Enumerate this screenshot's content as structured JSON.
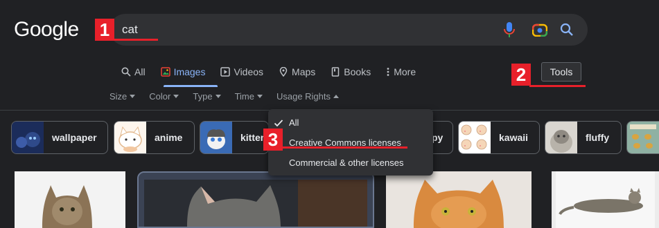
{
  "header": {
    "logo": "Google",
    "query": "cat"
  },
  "tabs": [
    {
      "label": "All",
      "icon": "search-icon"
    },
    {
      "label": "Images",
      "icon": "image-icon",
      "active": true
    },
    {
      "label": "Videos",
      "icon": "play-icon"
    },
    {
      "label": "Maps",
      "icon": "map-pin-icon"
    },
    {
      "label": "Books",
      "icon": "book-icon"
    },
    {
      "label": "More",
      "icon": "kebab-icon"
    }
  ],
  "tools_label": "Tools",
  "filters": [
    "Size",
    "Color",
    "Type",
    "Time",
    "Usage Rights"
  ],
  "chips": [
    "wallpaper",
    "anime",
    "kitten",
    "py",
    "kawaii",
    "fluffy"
  ],
  "dropdown": {
    "items": [
      "All",
      "Creative Commons licenses",
      "Commercial & other licenses"
    ],
    "selected": "All"
  },
  "markers": [
    "1",
    "2",
    "3"
  ],
  "colors": {
    "background": "#202124",
    "accent": "#8ab4f8",
    "marker": "#e8202a"
  }
}
